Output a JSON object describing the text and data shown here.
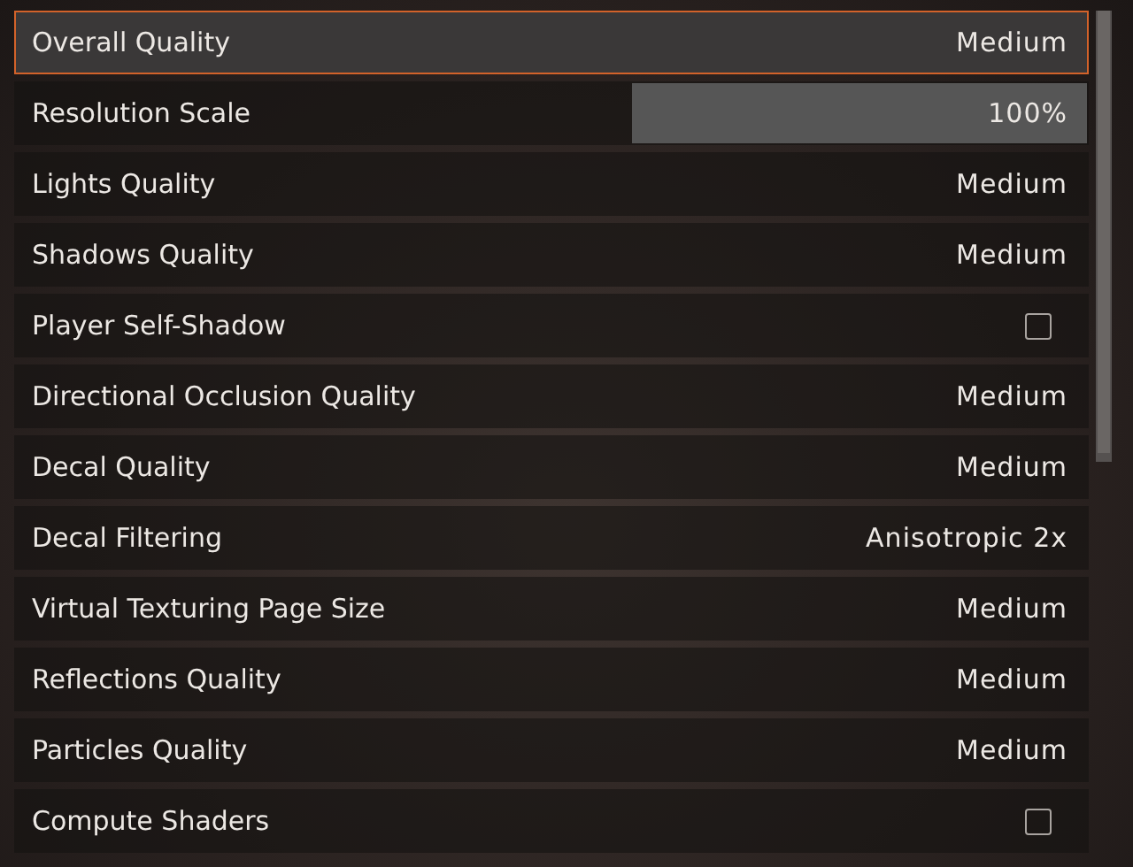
{
  "settings": [
    {
      "kind": "select",
      "label": "Overall Quality",
      "value": "Medium",
      "selected": true
    },
    {
      "kind": "slider",
      "label": "Resolution Scale",
      "value": "100%",
      "level": 1,
      "selected": false
    },
    {
      "kind": "select",
      "label": "Lights Quality",
      "value": "Medium",
      "selected": false
    },
    {
      "kind": "select",
      "label": "Shadows Quality",
      "value": "Medium",
      "selected": false
    },
    {
      "kind": "checkbox",
      "label": "Player Self-Shadow",
      "checked": false,
      "selected": false
    },
    {
      "kind": "select",
      "label": "Directional Occlusion Quality",
      "value": "Medium",
      "selected": false
    },
    {
      "kind": "select",
      "label": "Decal Quality",
      "value": "Medium",
      "selected": false
    },
    {
      "kind": "select",
      "label": "Decal Filtering",
      "value": "Anisotropic 2x",
      "selected": false
    },
    {
      "kind": "select",
      "label": "Virtual Texturing Page Size",
      "value": "Medium",
      "selected": false
    },
    {
      "kind": "select",
      "label": "Reflections Quality",
      "value": "Medium",
      "selected": false
    },
    {
      "kind": "select",
      "label": "Particles Quality",
      "value": "Medium",
      "selected": false
    },
    {
      "kind": "checkbox",
      "label": "Compute Shaders",
      "checked": false,
      "selected": false
    }
  ]
}
